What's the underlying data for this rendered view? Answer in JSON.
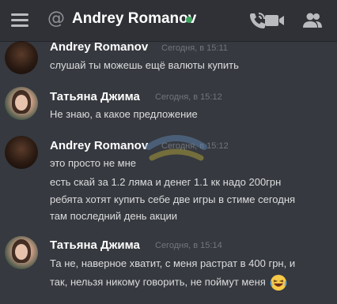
{
  "header": {
    "title": "Andrey Romanov",
    "at_symbol": "@"
  },
  "messages": [
    {
      "author": "Andrey Romanov",
      "timestamp": "Сегодня, в 15:11",
      "lines": [
        "слушай ты можешь ещё валюты купить"
      ]
    },
    {
      "author": "Татьяна Джима",
      "timestamp": "Сегодня, в 15:12",
      "lines": [
        "Не знаю, а какое предложение"
      ]
    },
    {
      "author": "Andrey Romanov",
      "timestamp": "Сегодня, в 15:12",
      "lines": [
        "это просто не мне",
        "есть скай за 1.2 ляма и денег 1.1 кк надо 200грн",
        "ребята хотят купить себе две игры в стиме сегодня",
        "там последний день акции"
      ]
    },
    {
      "author": "Татьяна Джима",
      "timestamp": "Сегодня, в 15:14",
      "lines": [
        "Та не, наверное хватит, с меня растрат в 400 грн, и",
        "так, нельзя никому говорить, не поймут меня"
      ]
    }
  ],
  "colors": {
    "background": "#36393f",
    "header": "#2f3136",
    "online": "#3ba55d",
    "text": "#dcddde",
    "muted": "#72767d"
  },
  "icons": [
    "menu-icon",
    "at-icon",
    "online-status-icon",
    "call-icon",
    "video-call-icon",
    "members-icon",
    "laughing-emoji-icon"
  ]
}
